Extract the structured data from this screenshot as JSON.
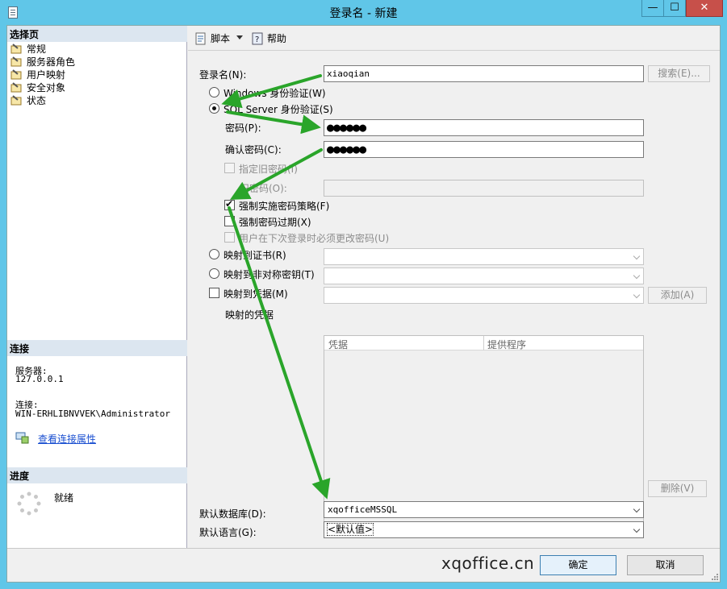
{
  "window": {
    "title": "登录名 - 新建",
    "minimize_glyph": "—",
    "maximize_glyph": "☐",
    "close_glyph": "✕"
  },
  "left": {
    "select_page_header": "选择页",
    "pages": [
      "常规",
      "服务器角色",
      "用户映射",
      "安全对象",
      "状态"
    ],
    "connection_header": "连接",
    "server_label": "服务器:",
    "server_value": "127.0.0.1",
    "connection_label": "连接:",
    "connection_value": "WIN-ERHLIBNVVEK\\Administrator",
    "view_props_link": "查看连接属性",
    "progress_header": "进度",
    "progress_status": "就绪"
  },
  "toolbar": {
    "script_label": "脚本",
    "help_label": "帮助"
  },
  "form": {
    "login_name_label": "登录名(N):",
    "login_name_value": "xiaoqian",
    "search_button": "搜索(E)...",
    "windows_auth_label": "Windows 身份验证(W)",
    "sql_auth_label": "SQL Server 身份验证(S)",
    "password_label": "密码(P):",
    "password_value": "●●●●●●",
    "confirm_password_label": "确认密码(C):",
    "confirm_password_value": "●●●●●●",
    "specify_old_password_label": "指定旧密码(I)",
    "old_password_label": "旧密码(O):",
    "enforce_policy_label": "强制实施密码策略(F)",
    "enforce_expiration_label": "强制密码过期(X)",
    "must_change_label": "用户在下次登录时必须更改密码(U)",
    "map_certificate_label": "映射到证书(R)",
    "map_asym_key_label": "映射到非对称密钥(T)",
    "map_credential_label": "映射到凭据(M)",
    "add_button": "添加(A)",
    "mapped_credentials_label": "映射的凭据",
    "grid_col_credential": "凭据",
    "grid_col_provider": "提供程序",
    "remove_button": "删除(V)",
    "default_db_label": "默认数据库(D):",
    "default_db_value": "xqofficeMSSQL",
    "default_lang_label": "默认语言(G):",
    "default_lang_value": "<默认值>"
  },
  "footer": {
    "watermark": "xqoffice.cn",
    "ok_button": "确定",
    "cancel_button": "取消"
  },
  "colors": {
    "title_bar": "#60c6e8",
    "close_button": "#c7504a",
    "annotation_arrow": "#2aa52a",
    "link": "#1a4fd0"
  }
}
